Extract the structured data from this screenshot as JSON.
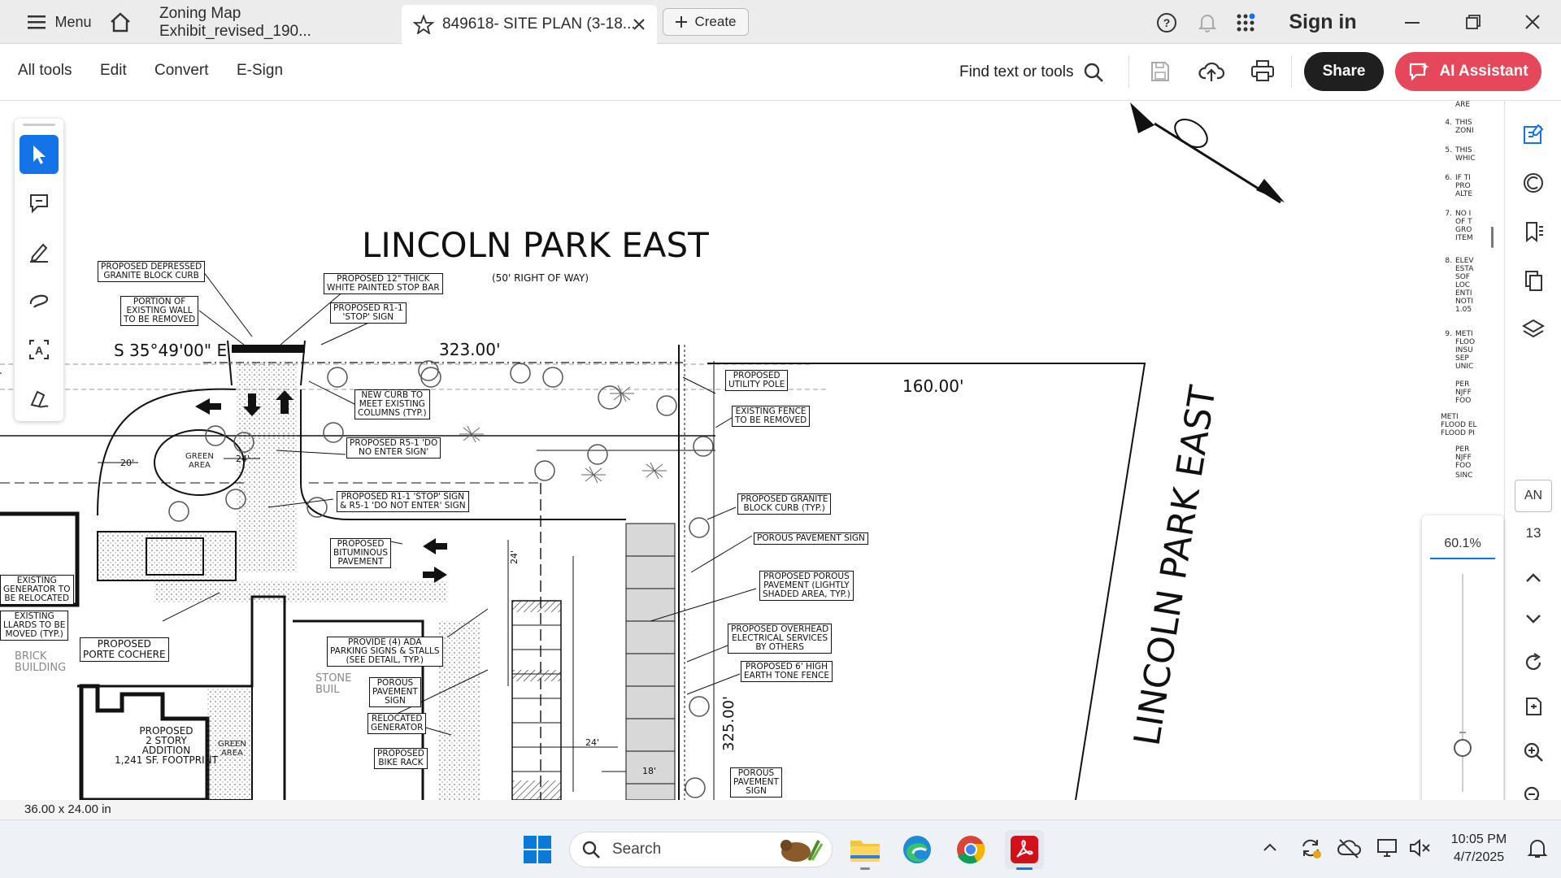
{
  "titlebar": {
    "menu_label": "Menu",
    "tabs": [
      {
        "label": "Zoning Map Exhibit_revised_190..."
      },
      {
        "label": "849618- SITE PLAN (3-18..."
      }
    ],
    "create_label": "Create",
    "signin_label": "Sign in"
  },
  "toolbar": {
    "menu": [
      "All tools",
      "Edit",
      "Convert",
      "E-Sign"
    ],
    "find_label": "Find text or tools",
    "share_label": "Share",
    "ai_label": "AI Assistant"
  },
  "plan": {
    "street_top": "LINCOLN PARK EAST",
    "row_width": "(50' RIGHT OF WAY)",
    "street_right": "LINCOLN PARK EAST",
    "bearing": "S 35°49'00\" E",
    "dim_323": "323.00'",
    "dim_160": "160.00'",
    "dim_325": "325.00'",
    "dim_20": "20'",
    "dim_24a": "24'",
    "dim_24b": "24'",
    "dim_24c": "24'",
    "dim_18": "18'",
    "green_area": "GREEN\nAREA",
    "green_area2": "GREEN\nAREA",
    "brick_building": "BRICK\nBUILDING",
    "stone_building": "STONE\nBUIL",
    "labels": [
      "PROPOSED DEPRESSED\nGRANITE BLOCK CURB",
      "PORTION OF\nEXISTING WALL\nTO BE REMOVED",
      "PROPOSED 12\" THICK\nWHITE PAINTED STOP BAR",
      "PROPOSED R1-1\n'STOP' SIGN",
      "NEW CURB TO\nMEET EXISTING\nCOLUMNS (TYP.)",
      "PROPOSED R5-1 'DO\nNO ENTER SIGN'",
      "PROPOSED R1-1 'STOP' SIGN\n& R5-1 'DO NOT ENTER' SIGN",
      "PROPOSED\nBITUMINOUS\nPAVEMENT",
      "PROPOSED\nUTILITY POLE",
      "EXISTING FENCE\nTO BE REMOVED",
      "PROPOSED GRANITE\nBLOCK CURB (TYP.)",
      "POROUS PAVEMENT SIGN",
      "PROPOSED POROUS\nPAVEMENT (LIGHTLY\nSHADED AREA, TYP.)",
      "PROPOSED OVERHEAD\nELECTRICAL SERVICES\nBY OTHERS",
      "PROPOSED 6' HIGH\nEARTH TONE FENCE",
      "PROVIDE (4) ADA\nPARKING SIGNS & STALLS\n(SEE DETAIL, TYP.)",
      "POROUS\nPAVEMENT\nSIGN",
      "RELOCATED\nGENERATOR",
      "PROPOSED\nBIKE RACK",
      "POROUS\nPAVEMENT\nSIGN",
      "PROPOSED\nPORTE COCHERE",
      "EXISTING\nGENERATOR TO\nBE RELOCATED",
      "EXISTING\nLLARDS TO BE\nMOVED (TYP.)",
      "PROPOSED\n2 STORY\nADDITION\n1,241 SF. FOOTPRINT"
    ],
    "notes": [
      {
        "num": "",
        "text": "ARE"
      },
      {
        "num": "4.",
        "text": "THIS\nZONI"
      },
      {
        "num": "5.",
        "text": "THIS\nWHIC"
      },
      {
        "num": "6.",
        "text": "IF TI\nPRO\nALTE"
      },
      {
        "num": "7.",
        "text": "NO I\nOF T\nGRO\nITEM"
      },
      {
        "num": "8.",
        "text": "ELEV\nESTA\nSOF\nLOC\nENTI\nNOTI\n1.05"
      },
      {
        "num": "9.",
        "text": "METI\nFLOO\nINSU\nSEP\nUNIC"
      },
      {
        "num": "",
        "text": "PER\nNJFF\nFOO"
      },
      {
        "num": "",
        "text": "METI\nFLOOD EL\nFLOOD PI"
      },
      {
        "num": "",
        "text": "PER\nNJFF\nFOO"
      },
      {
        "num": "",
        "text": "SINC"
      }
    ]
  },
  "rightrail": {
    "page_label": "AN",
    "page_number": "13"
  },
  "zoom": {
    "percent": "60.1%",
    "level": 0.2
  },
  "status": {
    "page_size": "36.00 x 24.00 in"
  },
  "taskbar": {
    "search_placeholder": "Search",
    "time": "10:05 PM",
    "date": "4/7/2025"
  },
  "colors": {
    "accent_blue": "#1473e6",
    "ai_red": "#e5485a",
    "share_bg": "#1f1f1f"
  }
}
